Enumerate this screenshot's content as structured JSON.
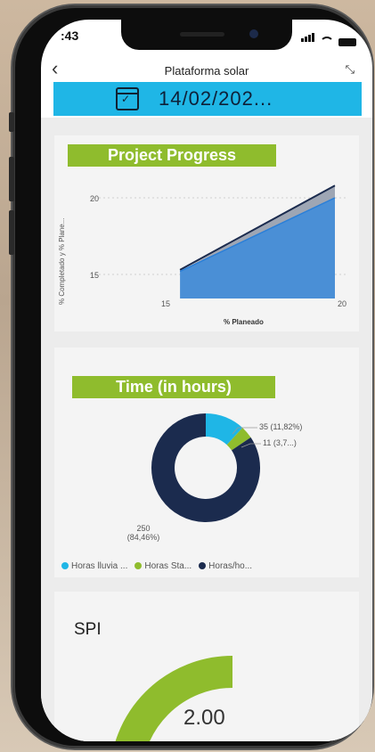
{
  "status": {
    "time": ":43"
  },
  "header": {
    "title": "Plataforma solar",
    "back_icon": "chevron-left-icon",
    "expand_icon": "collapse-icon"
  },
  "date_bar": {
    "icon": "calendar-check-icon",
    "date": "14/02/202...",
    "color": "#1fb6e6"
  },
  "card1": {
    "badge": "Project Progress"
  },
  "card2": {
    "badge": "Time (in hours)"
  },
  "card3": {
    "title": "SPI",
    "value": "2.00"
  },
  "colors": {
    "accent_green": "#8fbc2d",
    "navy": "#1b2b4e",
    "blue": "#3a93d8",
    "cyan": "#1fb6e6"
  },
  "chart_data": [
    {
      "type": "area",
      "xlabel": "% Planeado",
      "ylabel": "% Completado y % Plane...",
      "xlim": [
        15,
        20
      ],
      "ylim": [
        14,
        21.5
      ],
      "x_ticks": [
        "15",
        "20"
      ],
      "y_ticks": [
        "15",
        "20"
      ],
      "series": [
        {
          "x": [
            15.3,
            20
          ],
          "y": [
            15.2,
            20
          ]
        },
        {
          "x": [
            15.3,
            20
          ],
          "y": [
            15.3,
            20.8
          ]
        }
      ]
    },
    {
      "type": "pie",
      "legend": [
        "Horas lluvia ...",
        "Horas Sta...",
        "Horas/ho..."
      ],
      "values": [
        35,
        11,
        250
      ],
      "labels": [
        "35 (11,82%)",
        "11 (3,7...)",
        "250\n(84,46%)"
      ],
      "colors": [
        "#1fb6e6",
        "#8fbc2d",
        "#1b2b4e"
      ]
    },
    {
      "type": "gauge",
      "title": "SPI",
      "value": 2.0,
      "color": "#8fbc2d"
    }
  ]
}
